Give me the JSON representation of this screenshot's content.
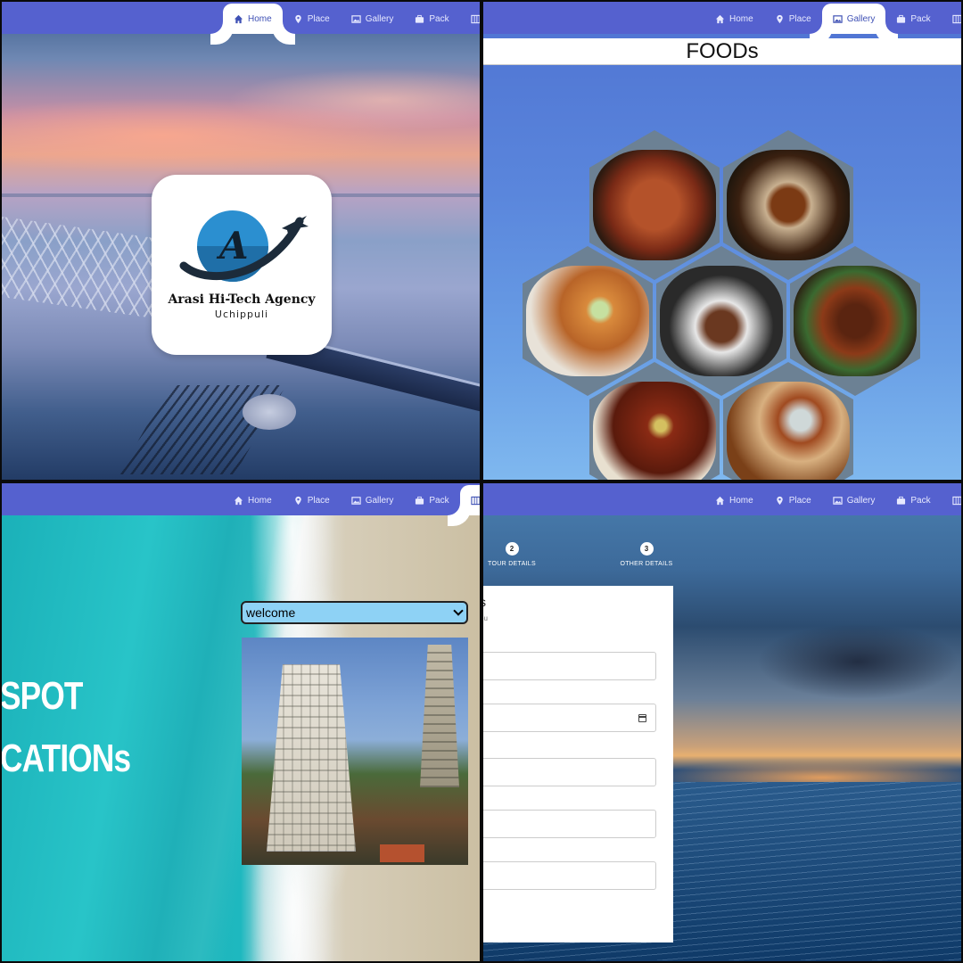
{
  "nav": {
    "home": "Home",
    "place": "Place",
    "gallery": "Gallery",
    "pack": "Pack"
  },
  "panel1": {
    "logo_title": "Arasi Hi-Tech Agency",
    "logo_sub": "Uchippuli",
    "logo_letter": "A"
  },
  "panel2": {
    "heading": "FOODs"
  },
  "panel3": {
    "hero_line1": "SPOT",
    "hero_line2": "CATIONs",
    "select_value": "welcome"
  },
  "panel4": {
    "steps": [
      {
        "number": "2",
        "label": "TOUR DETAILS"
      },
      {
        "number": "3",
        "label": "OTHER DETAILS"
      }
    ],
    "form_heading": "s",
    "form_sub": "ou"
  },
  "colors": {
    "navbar": "#5561cf",
    "active_tab_text": "#3f51b5",
    "select_bg": "#8ed2f5"
  }
}
